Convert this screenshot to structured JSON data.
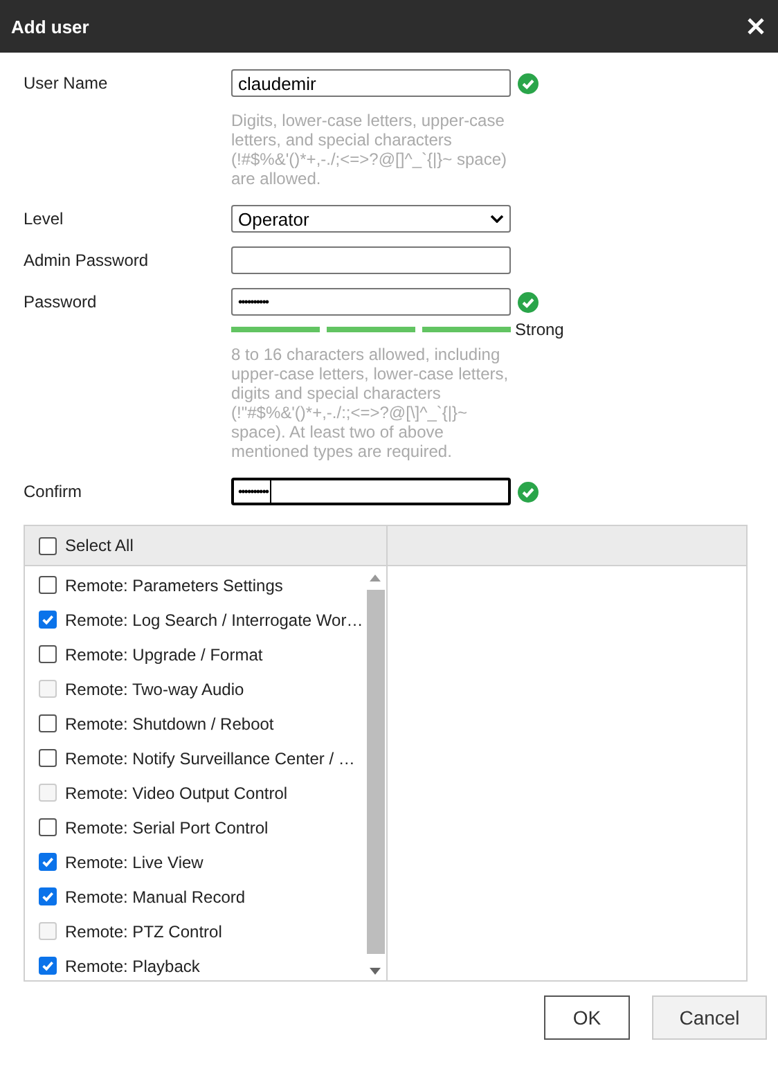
{
  "window": {
    "title": "Add user"
  },
  "fields": [
    {
      "kind": "text",
      "label": "User Name",
      "value": "claudemir",
      "valid": true,
      "hint": "Digits, lower-case letters, upper-case letters, and special characters (!#$%&'()*+,-./;<=>?@[]^_`{|}~ space) are allowed."
    },
    {
      "kind": "select",
      "label": "Level",
      "value": "Operator",
      "valid": false
    },
    {
      "kind": "password",
      "label": "Admin Password",
      "valid": false
    },
    {
      "kind": "password",
      "label": "Password",
      "value": "••••••••••",
      "valid": true,
      "strength": {
        "label": "Strong",
        "level": 1
      },
      "hint": "8 to 16 characters allowed, including upper-case letters, lower-case letters, digits and special characters (!\"#$%&'()*+,-./:;<=>?@[\\]^_`{|}~ space). At least two of above mentioned types are required."
    },
    {
      "kind": "password",
      "label": "Confirm",
      "value": "••••••••••",
      "valid": true,
      "focused": true
    }
  ],
  "permissions": {
    "select_all": {
      "label": "Select All",
      "checked": false
    },
    "items": [
      {
        "label": "Remote: Parameters Settings",
        "checked": false,
        "disabled": false
      },
      {
        "label": "Remote: Log Search / Interrogate Wor…",
        "checked": true,
        "disabled": false
      },
      {
        "label": "Remote: Upgrade / Format",
        "checked": false,
        "disabled": false
      },
      {
        "label": "Remote: Two-way Audio",
        "checked": false,
        "disabled": true
      },
      {
        "label": "Remote: Shutdown / Reboot",
        "checked": false,
        "disabled": false
      },
      {
        "label": "Remote: Notify Surveillance Center / …",
        "checked": false,
        "disabled": false
      },
      {
        "label": "Remote: Video Output Control",
        "checked": false,
        "disabled": true
      },
      {
        "label": "Remote: Serial Port Control",
        "checked": false,
        "disabled": false
      },
      {
        "label": "Remote: Live View",
        "checked": true,
        "disabled": false
      },
      {
        "label": "Remote: Manual Record",
        "checked": true,
        "disabled": false
      },
      {
        "label": "Remote: PTZ Control",
        "checked": false,
        "disabled": true
      },
      {
        "label": "Remote: Playback",
        "checked": true,
        "disabled": false
      }
    ]
  },
  "buttons": [
    {
      "label": "OK",
      "kind": "primary"
    },
    {
      "label": "Cancel",
      "kind": "secondary"
    }
  ]
}
